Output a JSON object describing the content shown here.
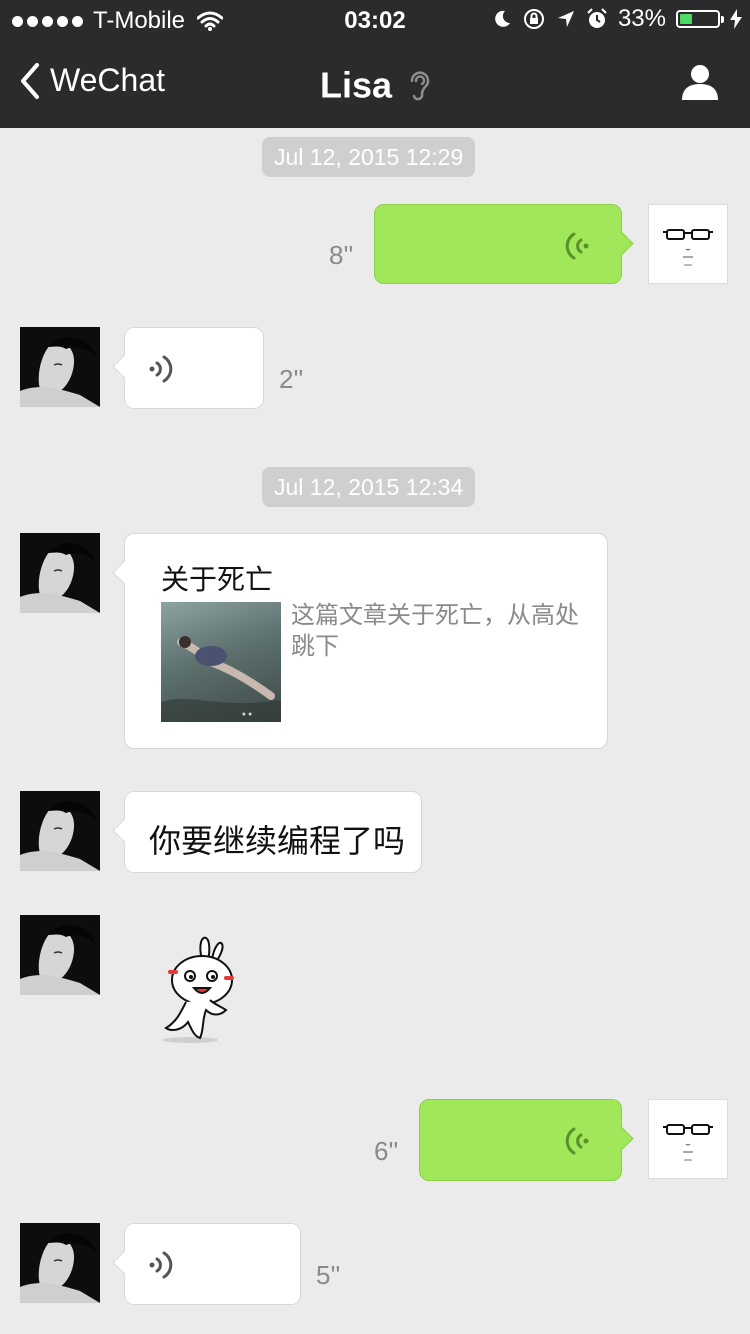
{
  "status_bar": {
    "carrier": "T-Mobile",
    "time": "03:02",
    "battery_percent": "33%",
    "battery_level": 0.33,
    "signal_bars": 5
  },
  "nav": {
    "back_label": "WeChat",
    "title": "Lisa"
  },
  "messages": {
    "ts1": "Jul 12, 2015 12:29",
    "voice1_duration": "8''",
    "voice2_duration": "2''",
    "ts2": "Jul 12, 2015 12:34",
    "article_title": "关于死亡",
    "article_desc": "这篇文章关于死亡，从高处跳下",
    "text1": "你要继续编程了吗",
    "voice3_duration": "6''",
    "voice4_duration": "5''"
  },
  "colors": {
    "nav_bg": "#2b2b2e",
    "chat_bg": "#ebebeb",
    "sent_bubble": "#a0e75a",
    "received_bubble": "#ffffff",
    "timestamp_bg": "#cfcfcf"
  },
  "icons": [
    "signal-dots-icon",
    "wifi-icon",
    "moon-icon",
    "orientation-lock-icon",
    "location-arrow-icon",
    "alarm-icon",
    "battery-icon",
    "charging-bolt-icon",
    "back-chevron-icon",
    "earpiece-icon",
    "profile-icon",
    "voice-wave-icon"
  ]
}
